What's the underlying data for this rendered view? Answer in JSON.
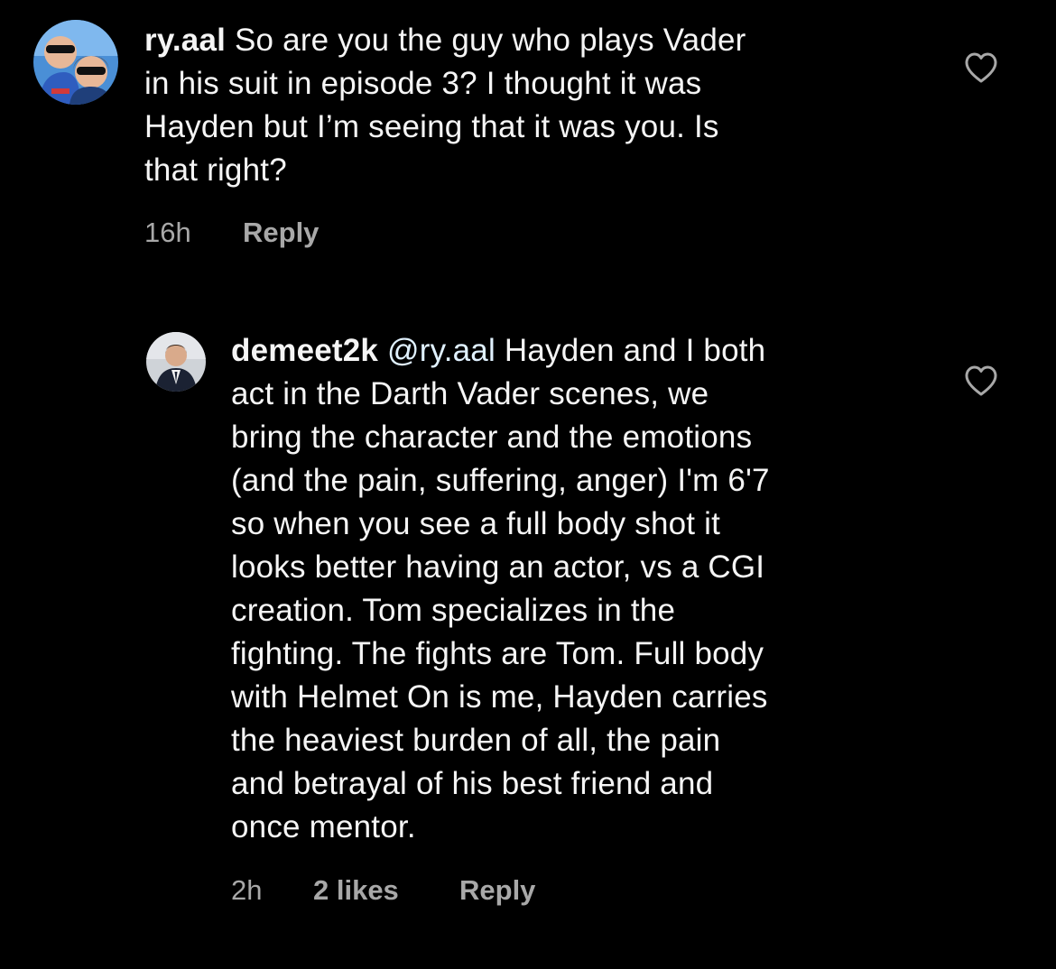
{
  "comments": [
    {
      "username": "ry.aal",
      "lines": [
        "So are you the guy who plays Vader",
        "in his suit in episode 3? I thought it was",
        "Hayden but I’m seeing that it was you. Is",
        "that right?"
      ],
      "time": "16h",
      "reply_label": "Reply",
      "avatar_icon": "profile-photo-couple-sunglasses",
      "like_icon": "heart-outline-icon"
    },
    {
      "username": "demeet2k",
      "mention": "@ry.aal",
      "lines": [
        "Hayden and I both",
        "act in the Darth Vader scenes, we",
        "bring the character and the emotions",
        "(and the pain, suffering, anger) I'm 6'7",
        "so when you see a full body shot it",
        "looks better having an actor, vs a CGI",
        "creation. Tom specializes in the",
        "fighting. The fights are Tom. Full body",
        "with Helmet On is me, Hayden carries",
        "the heaviest burden of all, the pain",
        "and betrayal of his best friend and",
        "once mentor."
      ],
      "time": "2h",
      "likes": "2 likes",
      "reply_label": "Reply",
      "avatar_icon": "profile-photo-man-suit",
      "like_icon": "heart-outline-icon"
    }
  ],
  "colors": {
    "background": "#000000",
    "text": "#f5f5f5",
    "meta": "#a8a8a8",
    "mention": "#e0f1ff"
  }
}
